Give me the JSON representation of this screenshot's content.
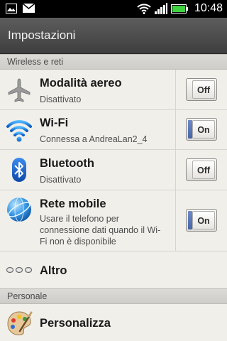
{
  "status_bar": {
    "time": "10:48",
    "icons": [
      "image-notification-icon",
      "mail-notification-icon",
      "wifi-signal-icon",
      "cell-signal-icon",
      "battery-icon"
    ]
  },
  "header": {
    "title": "Impostazioni"
  },
  "sections": {
    "wireless": {
      "label": "Wireless e reti"
    },
    "personal": {
      "label": "Personale"
    }
  },
  "rows": {
    "airplane": {
      "title": "Modalità aereo",
      "subtitle": "Disattivato",
      "toggle": "Off",
      "icon": "airplane-icon"
    },
    "wifi": {
      "title": "Wi-Fi",
      "subtitle": "Connessa a AndreaLan2_4",
      "toggle": "On",
      "icon": "wifi-icon"
    },
    "bluetooth": {
      "title": "Bluetooth",
      "subtitle": "Disattivato",
      "toggle": "Off",
      "icon": "bluetooth-icon"
    },
    "mobile": {
      "title": "Rete mobile",
      "subtitle": "Usare il telefono per connessione dati quando il Wi-Fi non è disponibile",
      "toggle": "On",
      "icon": "globe-icon"
    },
    "more": {
      "title": "Altro",
      "icon": "more-dots-icon"
    },
    "personalize": {
      "title": "Personalizza",
      "icon": "palette-icon"
    }
  },
  "colors": {
    "accent_on": "#4765a6",
    "header_bg": "#4a4a4a",
    "list_bg": "#f1efea"
  }
}
